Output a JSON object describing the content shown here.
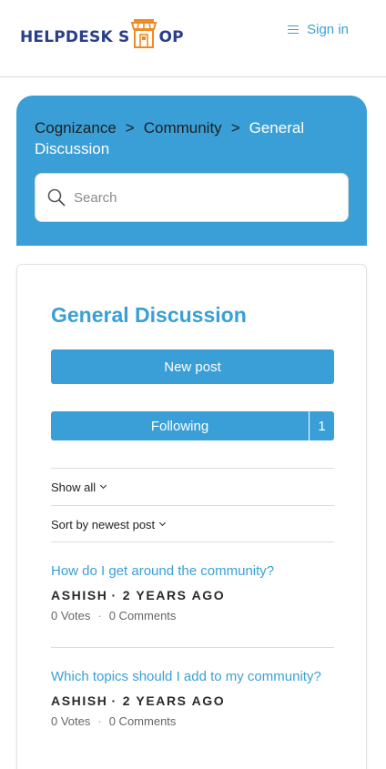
{
  "header": {
    "logo_text_left": "HELPDESK S",
    "logo_text_right": "OP",
    "sign_in_label": "Sign in"
  },
  "breadcrumb": {
    "items": [
      "Cognizance",
      "Community"
    ],
    "current": "General Discussion",
    "separator": ">"
  },
  "search": {
    "placeholder": "Search",
    "value": ""
  },
  "main": {
    "title": "General Discussion",
    "new_post_label": "New post",
    "following_label": "Following",
    "following_count": "1",
    "show_all_label": "Show all",
    "sort_label": "Sort by newest post"
  },
  "posts": [
    {
      "title": "How do I get around the community?",
      "author": "ASHISH",
      "age": "2 YEARS AGO",
      "votes": "0 Votes",
      "comments": "0 Comments"
    },
    {
      "title": "Which topics should I add to my community?",
      "author": "ASHISH",
      "age": "2 YEARS AGO",
      "votes": "0 Votes",
      "comments": "0 Comments"
    }
  ],
  "colors": {
    "accent": "#3a9fd6",
    "logo_navy": "#2a3f87",
    "logo_orange": "#f08a24"
  },
  "icons": {
    "logo": "shop-storefront-icon",
    "menu": "hamburger-icon",
    "search": "search-icon",
    "dropdown": "chevron-down-icon"
  }
}
